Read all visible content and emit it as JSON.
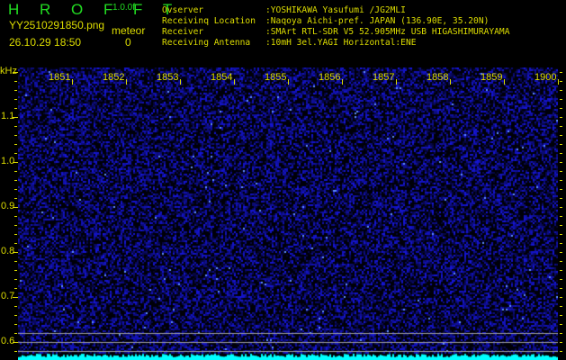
{
  "header": {
    "app_title": "H R O F F T",
    "version": "1.0.0f",
    "filename": "YY2510291850.png",
    "datetime": "26.10.29 18:50",
    "meteor_label": "meteor",
    "meteor_count": "0"
  },
  "info": [
    {
      "key": "Ovserver",
      "value": ":YOSHIKAWA Yasufumi /JG2MLI"
    },
    {
      "key": "Receivinq Location",
      "value": ":Naqoya Aichi-pref. JAPAN (136.90E, 35.20N)"
    },
    {
      "key": "Receiver",
      "value": ":SMArt RTL-SDR V5 52.905MHz USB HIGASHIMURAYAMA"
    },
    {
      "key": "Receiving Antenna",
      "value": ":10mH 3el.YAGI Horizontal:ENE"
    }
  ],
  "plot": {
    "y_unit": "kHz",
    "x_ticks": [
      "1851",
      "1852",
      "1853",
      "1854",
      "1855",
      "1856",
      "1857",
      "1858",
      "1859",
      "1900"
    ],
    "y_ticks": [
      "1.1",
      "1.0",
      "0.9",
      "0.8",
      "0.7",
      "0.6"
    ],
    "colors": {
      "background": "#000010",
      "noise": "#2020d0",
      "label": "#dddd00",
      "level": "#00ffff",
      "lines": "#a0a0a0"
    }
  }
}
